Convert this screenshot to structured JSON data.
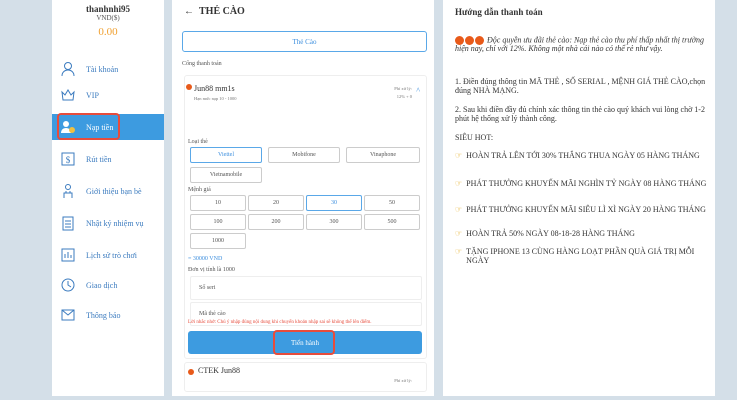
{
  "user": {
    "name": "thanhnhi95",
    "currency": "VND($)",
    "balance": "0.00"
  },
  "sidebar": {
    "items": [
      {
        "label": "Tài khoản",
        "icon": "user-icon"
      },
      {
        "label": "VIP",
        "icon": "vip-icon"
      },
      {
        "label": "Nạp tiền",
        "icon": "deposit-icon",
        "active": true
      },
      {
        "label": "Rút tiền",
        "icon": "withdraw-icon"
      },
      {
        "label": "Giới thiệu bạn bè",
        "icon": "referral-icon"
      },
      {
        "label": "Nhật ký nhiệm vụ",
        "icon": "task-log-icon"
      },
      {
        "label": "Lịch sử trò chơi",
        "icon": "game-history-icon"
      },
      {
        "label": "Giao dịch",
        "icon": "transaction-icon"
      },
      {
        "label": "Thông báo",
        "icon": "notification-icon"
      }
    ]
  },
  "main": {
    "back": "←",
    "title": "THẺ CÀO",
    "tab": "Thẻ Cào",
    "gateway_label": "Cổng thanh toán",
    "gateway": {
      "name": "Jun88 mm1s",
      "sub": "Hạn mức nạp 10 - 1000",
      "fee_label": "Phí xử lý:",
      "fee": "12% + 0"
    },
    "card_type_label": "Loại thẻ",
    "card_types": [
      "Viettel",
      "Mobifone",
      "Vinaphone",
      "Vietnamobile"
    ],
    "amount_label": "Mệnh giá",
    "amounts": [
      "10",
      "20",
      "30",
      "50",
      "100",
      "200",
      "300",
      "500",
      "1000"
    ],
    "selected_amount": "= 30000 VND",
    "unit_label": "Đơn vị tính là 1000",
    "serial_placeholder": "Số seri",
    "code_placeholder": "Mã thẻ cào",
    "warning": "Lời nhắc nhở: Chú ý nhập đúng nội dung khi chuyển khoản nhập sai sẽ không thể lên điểm.",
    "submit": "Tiến hành",
    "gateway2": {
      "name": "CTEK Jun88",
      "fee_label": "Phí xử lý:"
    }
  },
  "guide": {
    "title": "Hướng dẫn thanh toán",
    "promo": "Độc quyền ưu đãi thẻ cào: Nạp thẻ cào thu phí thấp nhất thị trường hiện nay, chỉ với 12%. Không một nhà cái nào có thể rẻ như vậy.",
    "step1": "1. Điền đúng thông tin MÃ THẺ , SỐ SERIAL , MỆNH GIÁ THẺ CÀO,chọn đúng NHÀ MẠNG.",
    "step2": "2. Sau khi điền đầy đủ chính xác thông tin thẻ cào quý khách vui lòng chờ 1-2 phút hệ thống xử lý thành công.",
    "hot_title": "SIÊU HOT:",
    "hot": [
      "HOÀN TRẢ LÊN TỚI 30% THẮNG THUA NGÀY 05 HÀNG THÁNG",
      "PHÁT THƯỞNG KHUYẾN MÃI NGHÌN TỶ NGÀY 08 HÀNG THÁNG",
      "PHÁT THƯỞNG KHUYẾN MÃI SIÊU LÌ XÌ NGÀY 20 HÀNG THÁNG",
      "HOÀN TRẢ 50% NGÀY 08-18-28 HÀNG THÁNG",
      "TẶNG IPHONE 13 CÙNG HÀNG LOẠT PHẦN QUÀ GIÁ TRỊ MỖI NGÀY"
    ]
  },
  "colors": {
    "accent": "#3d9be0",
    "highlight": "#e74c3c",
    "balance": "#f0a030"
  }
}
